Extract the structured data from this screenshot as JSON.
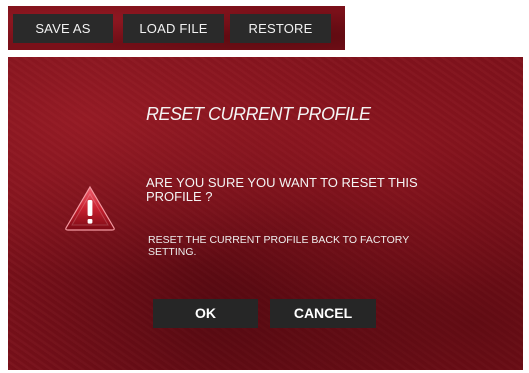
{
  "toolbar": {
    "save_as_label": "SAVE AS",
    "load_file_label": "LOAD FILE",
    "restore_label": "RESTORE"
  },
  "dialog": {
    "title": "RESET CURRENT PROFILE",
    "question": "ARE YOU SURE YOU WANT TO RESET THIS PROFILE ?",
    "description": "RESET THE CURRENT PROFILE BACK TO FACTORY SETTING.",
    "ok_label": "OK",
    "cancel_label": "CANCEL",
    "icon": "warning-icon"
  },
  "colors": {
    "background_red": "#7e111b",
    "button_dark": "#262626",
    "text_light": "#f4f4f4"
  }
}
